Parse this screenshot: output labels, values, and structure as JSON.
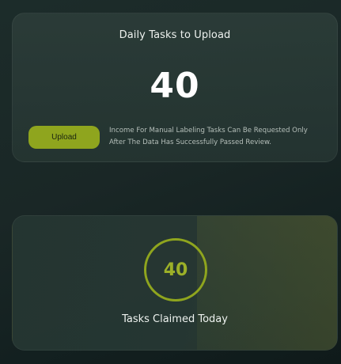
{
  "daily_card": {
    "title": "Daily Tasks to Upload",
    "count": "40",
    "upload_label": "Upload",
    "note": "Income For Manual Labeling Tasks Can Be Requested Only After The Data Has Successfully Passed Review."
  },
  "claimed_card": {
    "count": "40",
    "caption": "Tasks Claimed Today"
  },
  "colors": {
    "accent": "#8fa51e",
    "background": "#1a2726",
    "card": "#2a3b38"
  },
  "icons": []
}
